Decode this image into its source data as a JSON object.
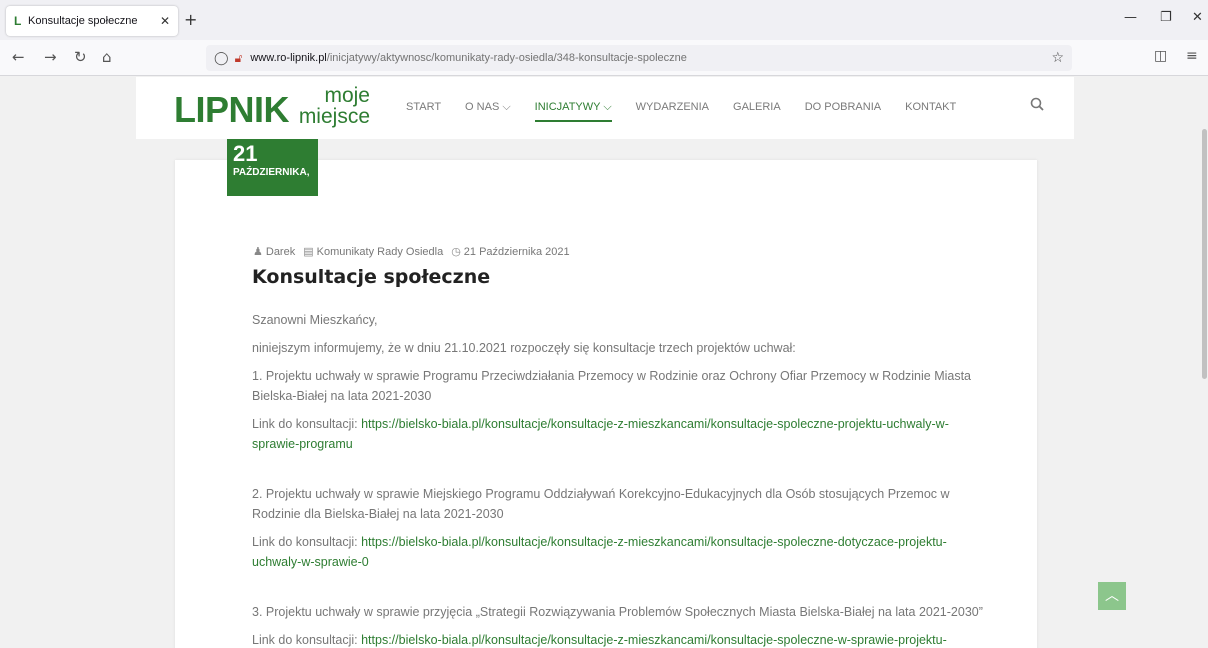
{
  "browser": {
    "tab_title": "Konsultacje społeczne",
    "tab_favicon": "L",
    "url_host": "www.ro-lipnik.pl",
    "url_path": "/inicjatywy/aktywnosc/komunikaty-rady-osiedla/348-konsultacje-spoleczne"
  },
  "site": {
    "logo_main": "LIPNIK",
    "logo_sub1": "moje",
    "logo_sub2": "miejsce",
    "menu": [
      "START",
      "O NAS ⌵",
      "INICJATYWY ⌵",
      "WYDARZENIA",
      "GALERIA",
      "DO POBRANIA",
      "KONTAKT"
    ]
  },
  "article": {
    "date_day": "21",
    "date_month": "PAŹDZIERNIKA,",
    "author": "Darek",
    "category": "Komunikaty Rady Osiedla",
    "date": "21 Października 2021",
    "title": "Konsultacje społeczne",
    "greeting": "Szanowni Mieszkańcy,",
    "intro": "niniejszym informujemy, że w dniu 21.10.2021 rozpoczęły się konsultacje trzech projektów uchwał:",
    "item1": "1. Projektu uchwały w sprawie Programu Przeciwdziałania Przemocy w Rodzinie oraz Ochrony Ofiar Przemocy w Rodzinie Miasta Bielska-Białej na lata 2021-2030",
    "link_label": "Link do konsultacji:",
    "link1": "https://bielsko-biala.pl/konsultacje/konsultacje-z-mieszkancami/konsultacje-spoleczne-projektu-uchwaly-w-sprawie-programu",
    "item2": "2. Projektu uchwały w sprawie Miejskiego Programu Oddziaływań Korekcyjno-Edukacyjnych dla Osób stosujących Przemoc w Rodzinie dla Bielska-Białej na lata 2021-2030",
    "link2": "https://bielsko-biala.pl/konsultacje/konsultacje-z-mieszkancami/konsultacje-spoleczne-dotyczace-projektu-uchwaly-w-sprawie-0",
    "item3": "3. Projektu uchwały w sprawie przyjęcia „Strategii Rozwiązywania Problemów Społecznych Miasta Bielska-Białej na lata 2021-2030”",
    "link3": "https://bielsko-biala.pl/konsultacje/konsultacje-z-mieszkancami/konsultacje-spoleczne-w-sprawie-projektu-"
  },
  "colors": {
    "brand": "#2e7d32"
  }
}
